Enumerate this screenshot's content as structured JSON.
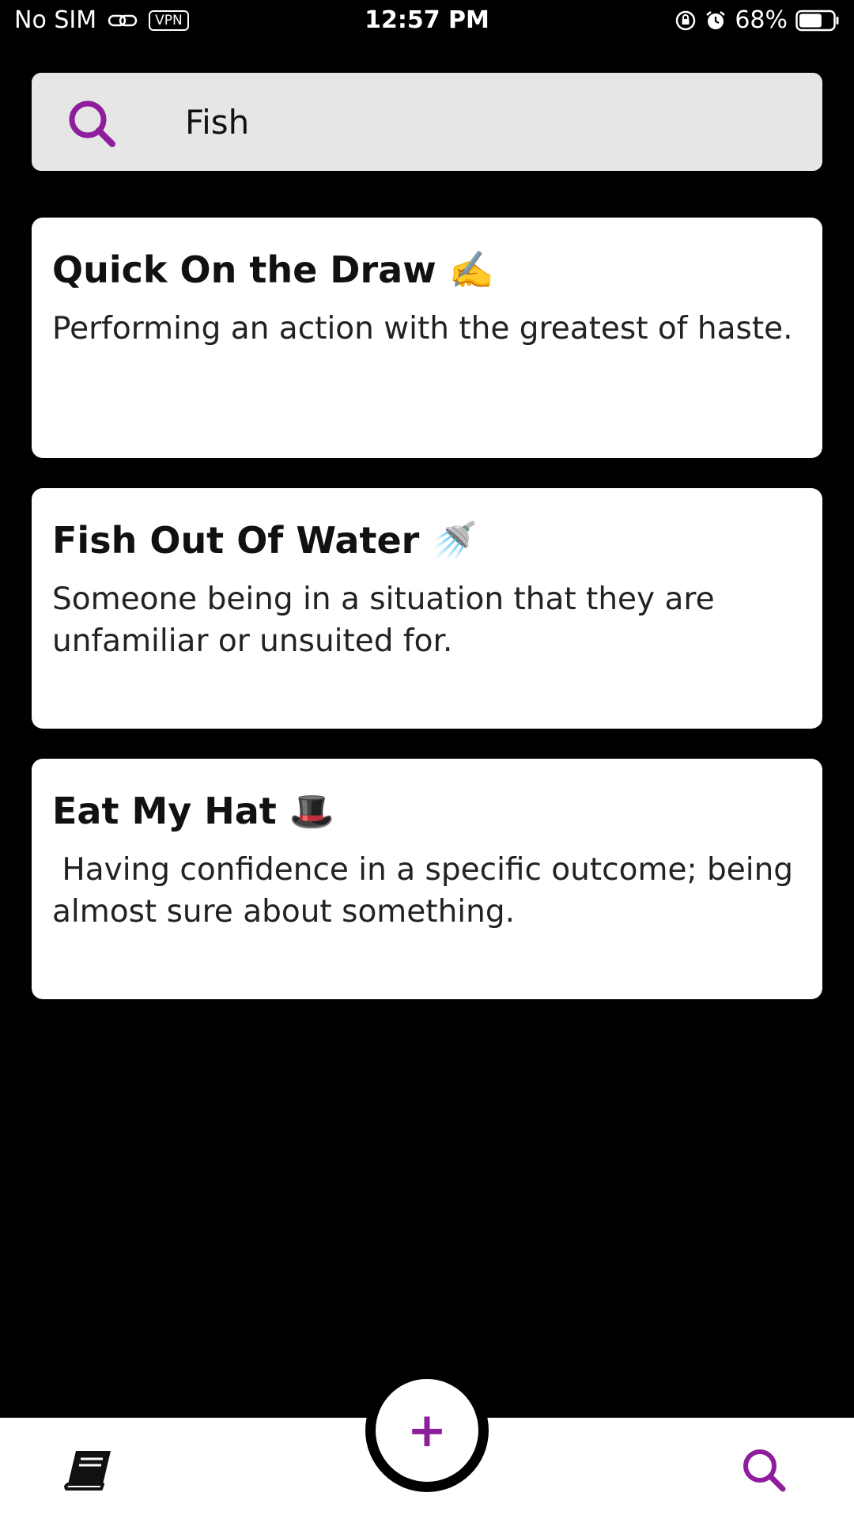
{
  "status_bar": {
    "carrier": "No SIM",
    "vpn_label": "VPN",
    "time": "12:57 PM",
    "battery": "68%",
    "battery_level": 0.68
  },
  "search": {
    "query": "Fish",
    "icon": "search-icon",
    "accent_color": "#8e1e9c"
  },
  "results": [
    {
      "title": "Quick On the Draw ✍️",
      "description": "Performing an action with the greatest of haste."
    },
    {
      "title": "Fish Out Of Water 🚿",
      "description": "Someone being in a situation that they are unfamiliar or unsuited for."
    },
    {
      "title": "Eat My Hat 🎩",
      "description": " Having confidence in a specific outcome; being almost sure about something."
    }
  ],
  "bottom_nav": {
    "add_label": "+",
    "left_icon": "book-icon",
    "right_icon": "search-icon"
  }
}
